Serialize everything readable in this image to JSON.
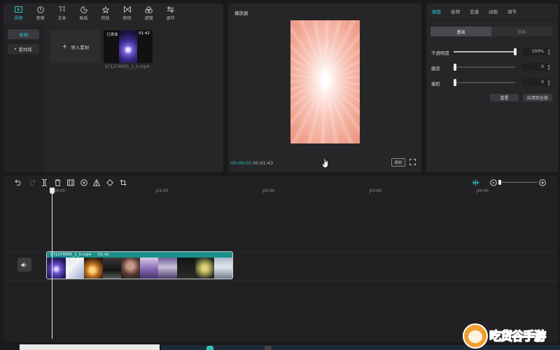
{
  "toolbar": {
    "items": [
      {
        "label": "视频",
        "icon": "video-icon",
        "active": true
      },
      {
        "label": "音频",
        "icon": "audio-icon",
        "active": false
      },
      {
        "label": "文本",
        "icon": "text-icon",
        "active": false
      },
      {
        "label": "贴纸",
        "icon": "sticker-icon",
        "active": false
      },
      {
        "label": "特效",
        "icon": "effects-icon",
        "active": false
      },
      {
        "label": "转场",
        "icon": "transition-icon",
        "active": false
      },
      {
        "label": "滤镜",
        "icon": "filter-icon",
        "active": false
      },
      {
        "label": "调节",
        "icon": "adjust-icon",
        "active": false
      }
    ]
  },
  "media": {
    "sidebar": {
      "local": "本地",
      "library": "素材库"
    },
    "import_label": "导入素材",
    "clip": {
      "badge": "已添加",
      "duration": "01:42",
      "filename": "971274955_1_0.mp4"
    }
  },
  "player": {
    "title": "播放器",
    "current_time": "00:00:02",
    "total_time": "00:01:43",
    "ratio_label": "原始"
  },
  "properties": {
    "tabs": [
      "画面",
      "音频",
      "变速",
      "动画",
      "调节"
    ],
    "active_tab": "画面",
    "segment": [
      "基础",
      "背景"
    ],
    "rows": [
      {
        "label": "不透明度",
        "value": "100%",
        "level": 1.0
      },
      {
        "label": "磨皮",
        "value": "0",
        "level": 0.0
      },
      {
        "label": "瘦脸",
        "value": "0",
        "level": 0.0
      }
    ],
    "reset_label": "重置",
    "apply_all_label": "应用到全部"
  },
  "timeline": {
    "ruler": [
      "00:00",
      "01:00",
      "02:00",
      "03:00",
      "04:00"
    ],
    "clip_name": "971274955_1_0.mp4",
    "clip_duration": "01:42"
  },
  "watermark": {
    "text": "吃货谷手游"
  },
  "colors": {
    "accent": "#2dc4c4",
    "clip_header": "#1b8f8a"
  }
}
